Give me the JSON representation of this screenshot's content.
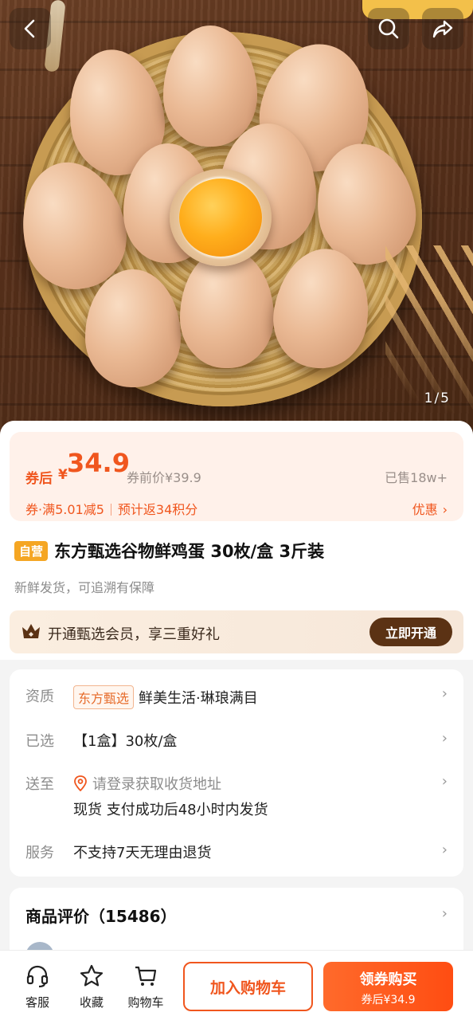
{
  "hero": {
    "pager": "1/5",
    "icons": [
      "back-arrow-icon",
      "search-icon",
      "share-icon"
    ]
  },
  "price": {
    "coupon_label": "券后",
    "currency": "¥",
    "value": "34.9",
    "original": "券前价¥39.9",
    "sold": "已售18w+",
    "promo_coupon": "券·满5.01减5",
    "promo_points": "预计返34积分",
    "discount_link": "优惠"
  },
  "product": {
    "self_tag": "自营",
    "title": "东方甄选谷物鲜鸡蛋 30枚/盒 3斤装",
    "subtitle": "新鲜发货，可追溯有保障"
  },
  "member": {
    "text": "开通甄选会员，享三重好礼",
    "button": "立即开通"
  },
  "info": {
    "qualification_label": "资质",
    "brand_tag": "东方甄选",
    "qualification_value": "鲜美生活·琳琅满目",
    "selected_label": "已选",
    "selected_value": "【1盒】30枚/盒",
    "ship_label": "送至",
    "ship_placeholder": "请登录获取收货地址",
    "ship_note": "现货 支付成功后48小时内发货",
    "service_label": "服务",
    "service_value": "不支持7天无理由退货"
  },
  "reviews": {
    "title": "商品评价（15486）"
  },
  "bottom": {
    "service": "客服",
    "favorite": "收藏",
    "cart": "购物车",
    "add_cart": "加入购物车",
    "buy": "领券购买",
    "buy_sub": "券后¥34.9"
  },
  "colors": {
    "accent": "#f0561e",
    "member_button": "#5b3214",
    "self_tag": "#f5a623"
  }
}
